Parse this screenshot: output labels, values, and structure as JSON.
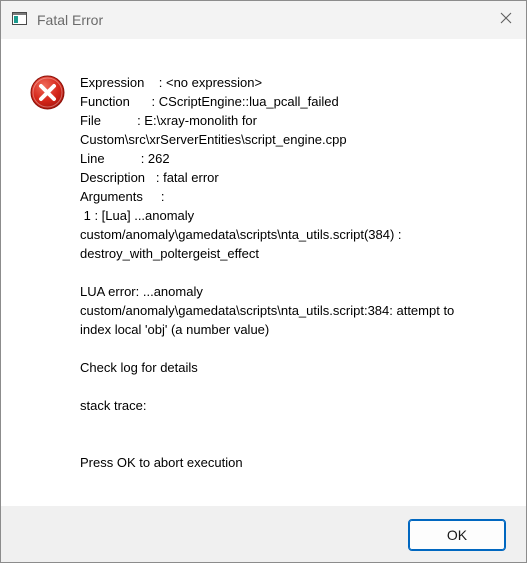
{
  "window": {
    "title": "Fatal Error",
    "icons": {
      "app": "application-window-icon",
      "close": "close-icon",
      "message": "error-icon"
    }
  },
  "message": {
    "lines": [
      "Expression    : <no expression>",
      "Function      : CScriptEngine::lua_pcall_failed",
      "File          : E:\\xray-monolith for",
      "Custom\\src\\xrServerEntities\\script_engine.cpp",
      "Line          : 262",
      "Description   : fatal error",
      "Arguments     :",
      " 1 : [Lua] ...anomaly",
      "custom/anomaly\\gamedata\\scripts\\nta_utils.script(384) :",
      "destroy_with_poltergeist_effect",
      "",
      "LUA error: ...anomaly",
      "custom/anomaly\\gamedata\\scripts\\nta_utils.script:384: attempt to",
      "index local 'obj' (a number value)",
      "",
      "Check log for details",
      "",
      "stack trace:",
      "",
      "",
      "Press OK to abort execution"
    ]
  },
  "buttons": {
    "ok_label": "OK"
  },
  "colors": {
    "error_red": "#d5261a",
    "accent": "#0067c0",
    "footer_bg": "#f0f0f0",
    "titlebar_bg": "#f3f3f3"
  }
}
